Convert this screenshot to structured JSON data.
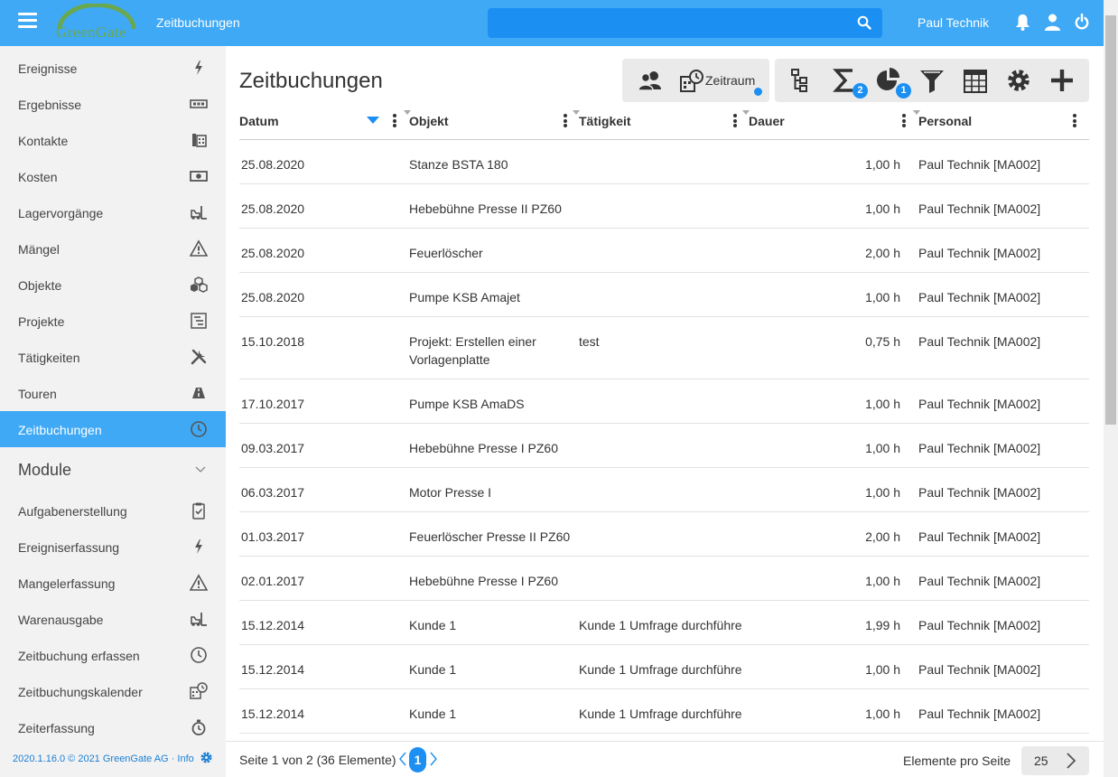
{
  "header": {
    "logo_text": "GreenGate",
    "app_title": "Zeitbuchungen",
    "search_placeholder": "",
    "user_name": "Paul Technik"
  },
  "sidebar": {
    "items": [
      {
        "label": "Ereignisse",
        "icon": "bolt-icon"
      },
      {
        "label": "Ergebnisse",
        "icon": "counter-icon"
      },
      {
        "label": "Kontakte",
        "icon": "phonebook-icon"
      },
      {
        "label": "Kosten",
        "icon": "money-icon"
      },
      {
        "label": "Lagervorgänge",
        "icon": "forklift-icon"
      },
      {
        "label": "Mängel",
        "icon": "warning-icon"
      },
      {
        "label": "Objekte",
        "icon": "cubes-icon"
      },
      {
        "label": "Projekte",
        "icon": "project-icon"
      },
      {
        "label": "Tätigkeiten",
        "icon": "tools-icon"
      },
      {
        "label": "Touren",
        "icon": "road-icon"
      },
      {
        "label": "Zeitbuchungen",
        "icon": "clock-icon",
        "active": true
      }
    ],
    "module_title": "Module",
    "module_items": [
      {
        "label": "Aufgabenerstellung",
        "icon": "clipboard-icon"
      },
      {
        "label": "Ereigniserfassung",
        "icon": "bolt-icon"
      },
      {
        "label": "Mangelerfassung",
        "icon": "warning-icon"
      },
      {
        "label": "Warenausgabe",
        "icon": "forklift-icon"
      },
      {
        "label": "Zeitbuchung erfassen",
        "icon": "clock-icon"
      },
      {
        "label": "Zeitbuchungskalender",
        "icon": "calendar-clock-icon"
      },
      {
        "label": "Zeiterfassung",
        "icon": "stopwatch-icon"
      }
    ],
    "footer": "2020.1.16.0 © 2021 GreenGate AG · Info"
  },
  "main": {
    "title": "Zeitbuchungen",
    "toolbar": {
      "zeitraum_label": "Zeitraum",
      "sum_badge": "2",
      "chart_badge": "1"
    },
    "columns": [
      "Datum",
      "Objekt",
      "Tätigkeit",
      "Dauer",
      "Personal"
    ],
    "rows": [
      {
        "datum": "25.08.2020",
        "objekt": "Stanze BSTA 180",
        "taetigkeit": "",
        "dauer": "1,00 h",
        "personal": "Paul Technik [MA002]"
      },
      {
        "datum": "25.08.2020",
        "objekt": "Hebebühne Presse II PZ60",
        "taetigkeit": "",
        "dauer": "1,00 h",
        "personal": "Paul Technik [MA002]"
      },
      {
        "datum": "25.08.2020",
        "objekt": "Feuerlöscher",
        "taetigkeit": "",
        "dauer": "2,00 h",
        "personal": "Paul Technik [MA002]"
      },
      {
        "datum": "25.08.2020",
        "objekt": "Pumpe KSB Amajet",
        "taetigkeit": "",
        "dauer": "1,00 h",
        "personal": "Paul Technik [MA002]"
      },
      {
        "datum": "15.10.2018",
        "objekt": "Projekt: Erstellen einer Vorlagenplatte",
        "taetigkeit": "test",
        "dauer": "0,75 h",
        "personal": "Paul Technik [MA002]"
      },
      {
        "datum": "17.10.2017",
        "objekt": "Pumpe KSB AmaDS",
        "taetigkeit": "",
        "dauer": "1,00 h",
        "personal": "Paul Technik [MA002]"
      },
      {
        "datum": "09.03.2017",
        "objekt": "Hebebühne Presse I PZ60",
        "taetigkeit": "",
        "dauer": "1,00 h",
        "personal": "Paul Technik [MA002]"
      },
      {
        "datum": "06.03.2017",
        "objekt": "Motor Presse I",
        "taetigkeit": "",
        "dauer": "1,00 h",
        "personal": "Paul Technik [MA002]"
      },
      {
        "datum": "01.03.2017",
        "objekt": "Feuerlöscher Presse II PZ60",
        "taetigkeit": "",
        "dauer": "2,00 h",
        "personal": "Paul Technik [MA002]"
      },
      {
        "datum": "02.01.2017",
        "objekt": "Hebebühne Presse I PZ60",
        "taetigkeit": "",
        "dauer": "1,00 h",
        "personal": "Paul Technik [MA002]"
      },
      {
        "datum": "15.12.2014",
        "objekt": "Kunde 1",
        "taetigkeit": "Kunde 1 Umfrage durchführe",
        "dauer": "1,99 h",
        "personal": "Paul Technik [MA002]"
      },
      {
        "datum": "15.12.2014",
        "objekt": "Kunde 1",
        "taetigkeit": "Kunde 1 Umfrage durchführe",
        "dauer": "1,00 h",
        "personal": "Paul Technik [MA002]"
      },
      {
        "datum": "15.12.2014",
        "objekt": "Kunde 1",
        "taetigkeit": "Kunde 1 Umfrage durchführe",
        "dauer": "1,00 h",
        "personal": "Paul Technik [MA002]"
      }
    ]
  },
  "pagination": {
    "summary": "Seite 1 von 2 (36 Elemente)",
    "current_page": "1",
    "per_page_label": "Elemente pro Seite",
    "per_page_value": "25"
  },
  "colors": {
    "accent": "#3fa9f5",
    "accent_dark": "#1b8ff2",
    "sidebar_bg": "#f2f2f2"
  }
}
